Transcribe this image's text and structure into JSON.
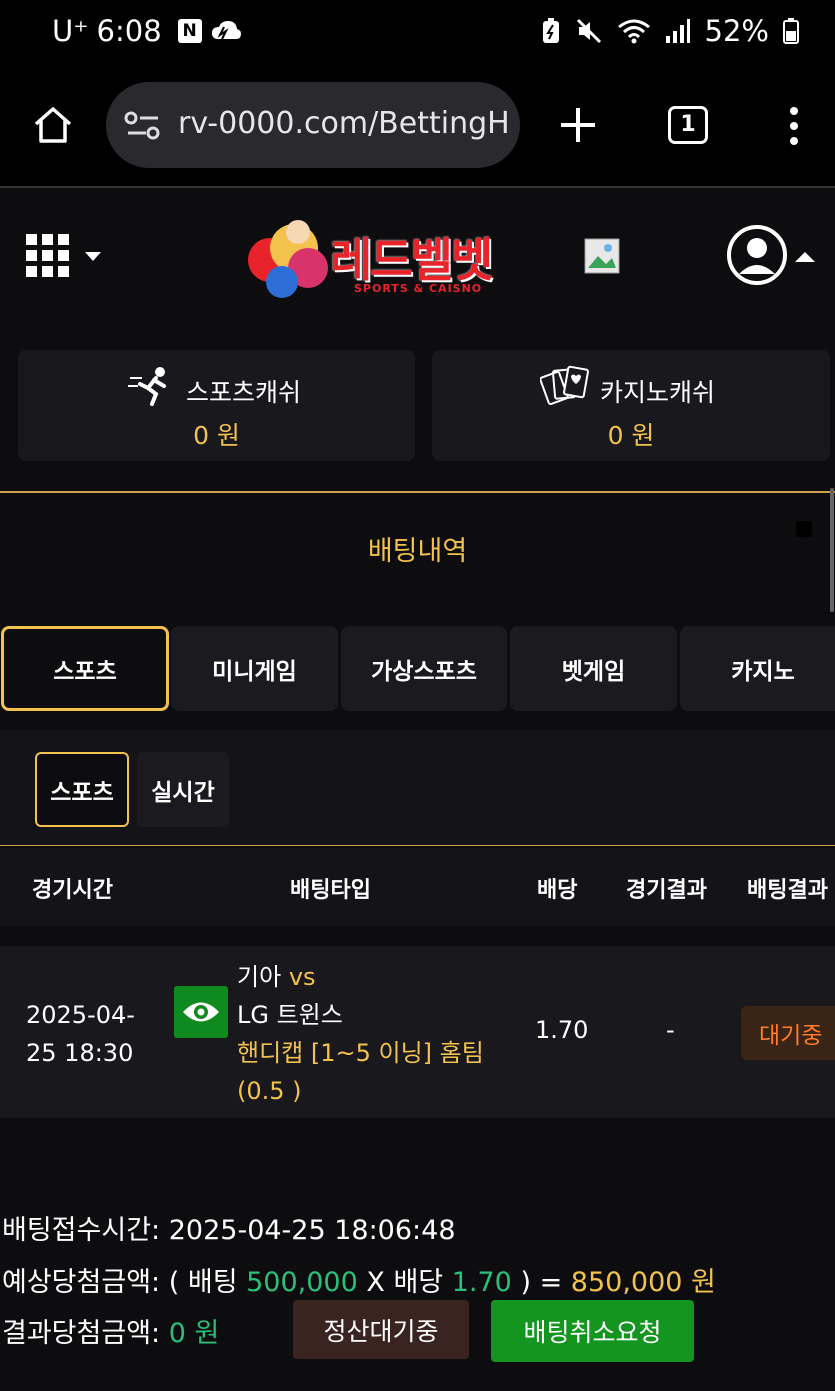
{
  "status_bar": {
    "carrier": "U⁺",
    "time": "6:08",
    "notif_icon": "N",
    "battery": "52%"
  },
  "browser": {
    "url": "rv-0000.com/BettingH",
    "tab_count": "1"
  },
  "site": {
    "logo_text": "레드벨벳",
    "logo_sub": "SPORTS & CAISNO"
  },
  "cash": {
    "sports_label": "스포츠캐쉬",
    "sports_value": "0 원",
    "casino_label": "카지노캐쉬",
    "casino_value": "0 원"
  },
  "section": {
    "title": "배팅내역"
  },
  "tabs": [
    {
      "label": "스포츠",
      "active": true
    },
    {
      "label": "미니게임",
      "active": false
    },
    {
      "label": "가상스포츠",
      "active": false
    },
    {
      "label": "벳게임",
      "active": false
    },
    {
      "label": "카지노",
      "active": false
    }
  ],
  "subtabs": [
    {
      "label": "스포츠",
      "active": true
    },
    {
      "label": "실시간",
      "active": false
    }
  ],
  "table": {
    "headers": [
      "경기시간",
      "배팅타입",
      "배당",
      "경기결과",
      "배팅결과"
    ],
    "rows": [
      {
        "date": "2025-04-",
        "date2": "25 18:30",
        "team_home": "기아",
        "vs": "vs",
        "team_away": "LG 트윈스",
        "bet_type": "핸디캡 [1~5 이닝] 홈팀",
        "bet_value": "(0.5 )",
        "odds": "1.70",
        "result": "-",
        "status": "대기중"
      }
    ]
  },
  "summary": {
    "received_label": "배팅접수시간:",
    "received_value": "2025-04-25 18:06:48",
    "expected_label": "예상당첨금액:",
    "open_paren": "( 배팅",
    "stake": "500,000",
    "x_label": "X 배당",
    "odds": "1.70",
    "eq": ") =",
    "expected_value": "850,000 원",
    "result_label": "결과당첨금액:",
    "result_value": "0 원",
    "btn_wait": "정산대기중",
    "btn_cancel": "배팅취소요청"
  },
  "colors": {
    "gold": "#f2c14e",
    "green": "#2bbf7a",
    "button_green": "#14951f",
    "wait_orange": "#ff7a2a"
  }
}
